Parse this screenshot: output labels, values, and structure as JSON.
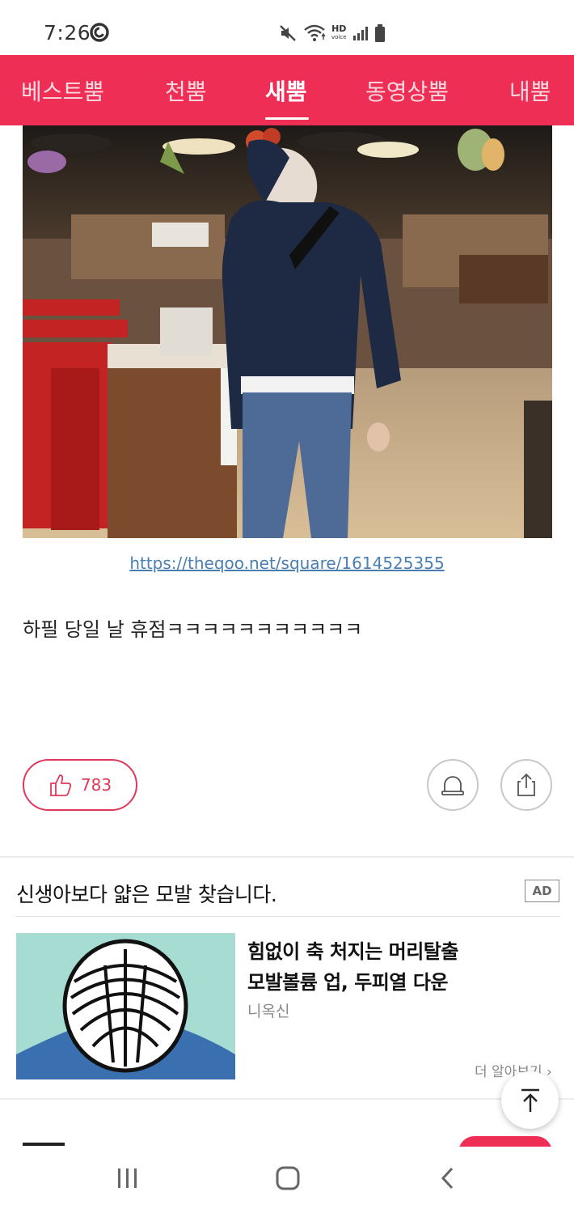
{
  "status_bar": {
    "time": "7:26",
    "hd_label": "HD",
    "voice_label": "voice",
    "icons": [
      "c-badge-icon",
      "mute-icon",
      "wifi-icon",
      "signal-icon",
      "battery-icon"
    ]
  },
  "nav": {
    "tabs": [
      {
        "label": "베스트뿜",
        "active": false
      },
      {
        "label": "천뿜",
        "active": false
      },
      {
        "label": "새뿜",
        "active": true
      },
      {
        "label": "동영상뿜",
        "active": false
      },
      {
        "label": "내뿜",
        "active": false
      }
    ]
  },
  "post": {
    "link": "https://theqoo.net/square/1614525355",
    "text": "하필 당일 날 휴점ㅋㅋㅋㅋㅋㅋㅋㅋㅋㅋㅋ",
    "like_count": "783"
  },
  "ad": {
    "heading": "신생아보다 얇은 모발 찾습니다.",
    "badge": "AD",
    "title_line1": "힘없이 축 처지는 머리탈출",
    "title_line2": "모발볼륨 업, 두피열 다운",
    "brand": "니옥신",
    "more": "더 알아보기 ›"
  },
  "colors": {
    "brand": "#ee2e55",
    "link": "#4a7fb3",
    "like_accent": "#e0385a"
  }
}
